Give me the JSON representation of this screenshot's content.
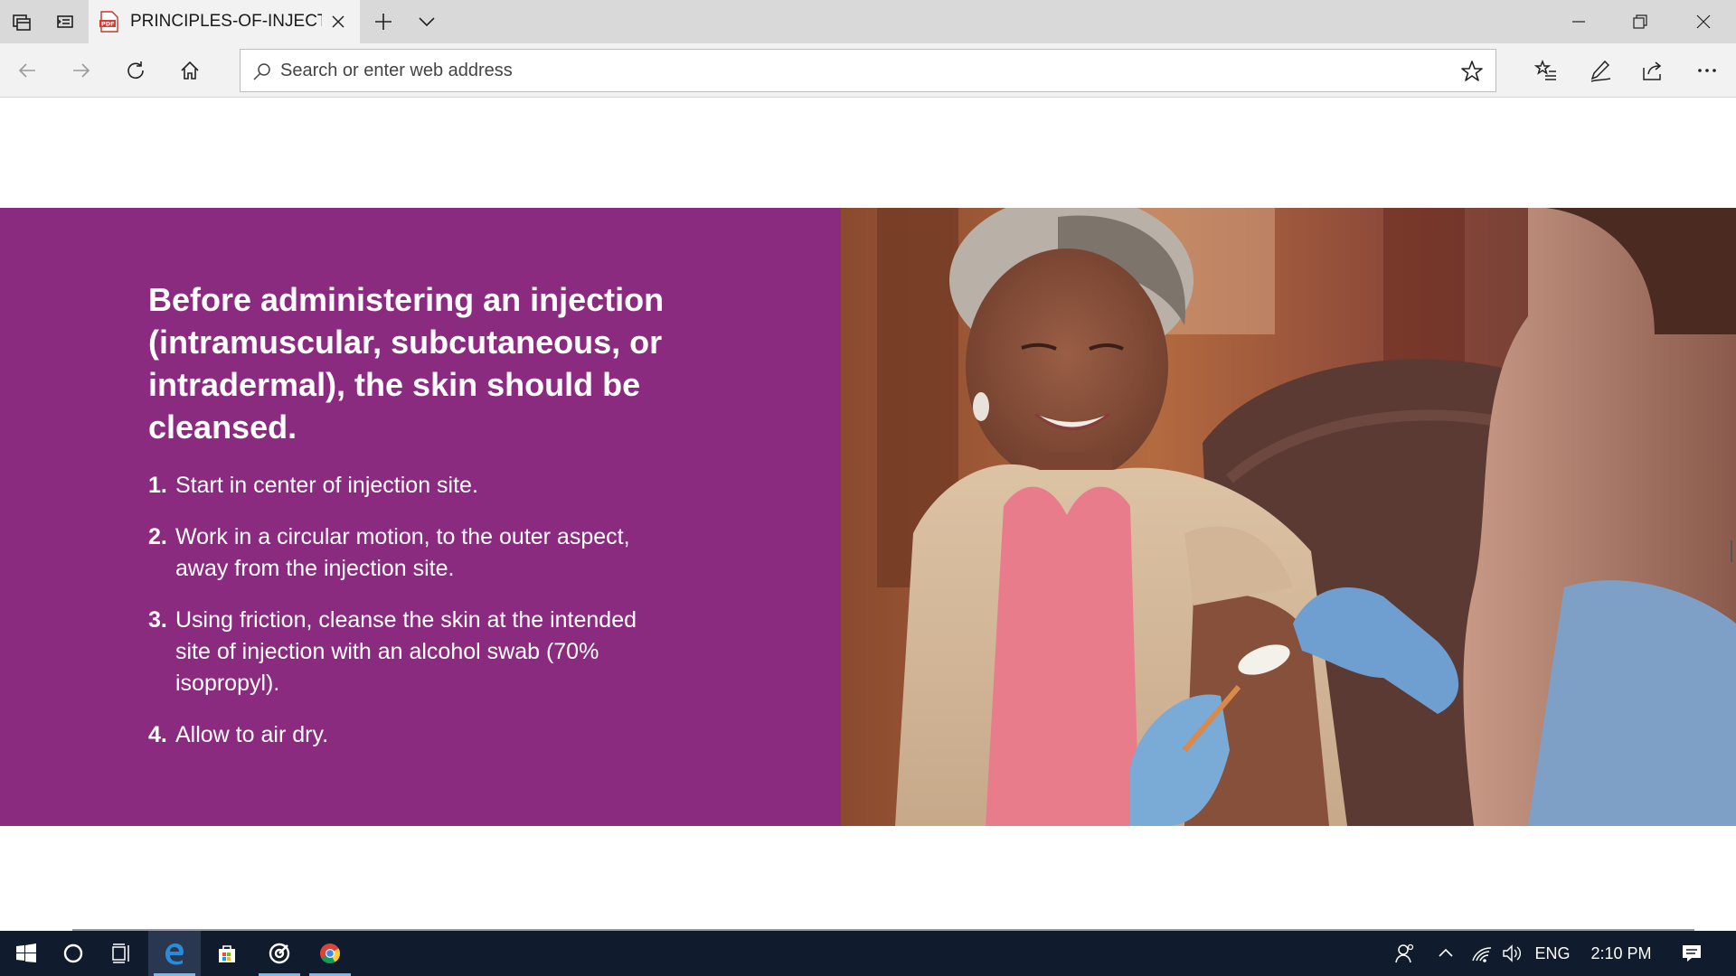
{
  "browser": {
    "tab_title": "PRINCIPLES-OF-INJECTI",
    "address_placeholder": "Search or enter web address"
  },
  "icons": {
    "tab_bar": [
      "tabs-aside-icon",
      "restore-tabs-icon",
      "pdf-icon",
      "close-tab-icon",
      "new-tab-icon",
      "tab-preview-chevron-icon"
    ],
    "window": [
      "minimize-icon",
      "maximize-icon",
      "close-window-icon"
    ],
    "nav": [
      "back-arrow-icon",
      "forward-arrow-icon",
      "refresh-icon",
      "home-icon",
      "search-icon",
      "favorite-star-icon",
      "favorites-list-icon",
      "pen-icon",
      "share-icon",
      "more-icon"
    ],
    "taskbar": [
      "windows-logo-icon",
      "cortana-circle-icon",
      "task-view-icon",
      "edge-e-icon",
      "store-bag-icon",
      "target-app-icon",
      "chrome-icon"
    ],
    "tray": [
      "people-icon",
      "chevron-up-icon",
      "wifi-icon",
      "speaker-icon",
      "notification-icon"
    ]
  },
  "content": {
    "heading": "Before administering an injection (intramuscular, subcutaneous, or intradermal), the skin should be cleansed.",
    "steps": [
      {
        "num": "1.",
        "text": "Start in center of injection site."
      },
      {
        "num": "2.",
        "text": "Work in a circular motion, to the outer aspect, away from the injection site."
      },
      {
        "num": "3.",
        "text": "Using friction, cleanse the skin at the intended site of injection with an alcohol swab (70% isopropyl)."
      },
      {
        "num": "4.",
        "text": "Allow to air dry."
      }
    ],
    "photo_alt": "Nurse wearing blue gloves cleansing the upper arm of a smiling older woman"
  },
  "taskbar": {
    "language": "ENG",
    "time": "2:10 PM"
  },
  "colors": {
    "panel": "#8a2b80",
    "taskbar": "#101b2d",
    "tab_bar": "#d9d9d9",
    "toolbar": "#f2f2f2"
  }
}
